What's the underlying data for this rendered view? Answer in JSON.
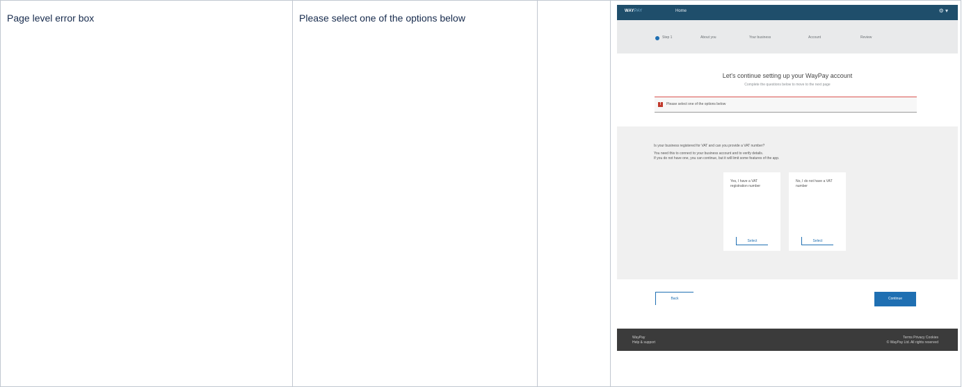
{
  "table": {
    "col1_text": "Page level error box",
    "col2_text": "Please select one of the options below",
    "col3_text": ""
  },
  "mockup": {
    "brand_main": "WAY",
    "brand_accent": "PAY",
    "nav_label": "Home",
    "user_label": "⚙ ▾",
    "steps": [
      "Step 1",
      "About you",
      "Your business",
      "Account",
      "Review"
    ],
    "title": "Let's continue setting up your WayPay account",
    "subtitle": "Complete the questions below to move to the next page",
    "error_text": "Please select one of the options below",
    "body_lines": [
      "Is your business registered for VAT and can you provide a VAT number?",
      "You need this to connect to your business account and to verify details.",
      "If you do not have one, you can continue, but it will limit some features of the app."
    ],
    "cards": [
      {
        "text": "Yes, I have a VAT registration number",
        "button": "Select"
      },
      {
        "text": "No, I do not have a VAT number",
        "button": "Select"
      }
    ],
    "back_label": "Back",
    "continue_label": "Continue",
    "footer_left": [
      "WayPay",
      "Help & support"
    ],
    "footer_right": [
      "Terms  Privacy  Cookies",
      "© WayPay Ltd. All rights reserved"
    ]
  },
  "colors": {
    "topbar": "#1f4e6b",
    "primary": "#1f6fb2",
    "error": "#d9534f",
    "footer": "#3b3b3b"
  }
}
